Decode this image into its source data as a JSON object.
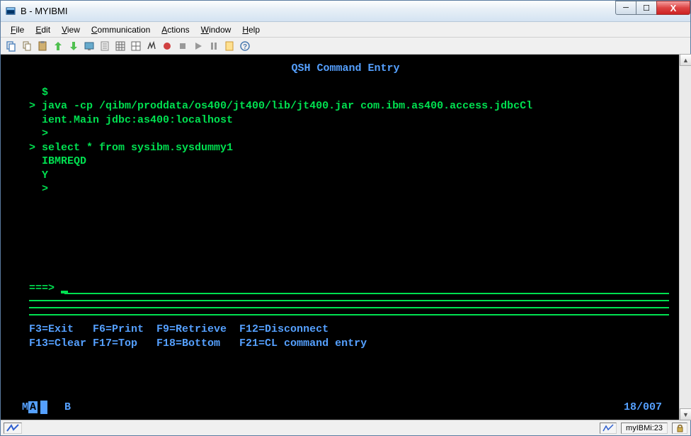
{
  "window": {
    "title": "B - MYIBMI"
  },
  "menu": {
    "items": [
      {
        "u": "F",
        "rest": "ile"
      },
      {
        "u": "E",
        "rest": "dit"
      },
      {
        "u": "V",
        "rest": "iew"
      },
      {
        "u": "C",
        "rest": "ommunication"
      },
      {
        "u": "A",
        "rest": "ctions"
      },
      {
        "u": "W",
        "rest": "indow"
      },
      {
        "u": "H",
        "rest": "elp"
      }
    ]
  },
  "terminal": {
    "title": "QSH Command Entry",
    "lines": {
      "l0": "  $",
      "l1": "> java -cp /qibm/proddata/os400/jt400/lib/jt400.jar com.ibm.as400.access.jdbcCl",
      "l2": "  ient.Main jdbc:as400:localhost",
      "l3": "  >",
      "l4": "> select * from sysibm.sysdummy1",
      "l5": "  IBMREQD",
      "l6": "  Y",
      "l7": "  >"
    },
    "prompt": "===> ",
    "fkeys": {
      "row1": "F3=Exit   F6=Print  F9=Retrieve  F12=Disconnect",
      "row2": "F13=Clear F17=Top   F18=Bottom   F21=CL command entry"
    },
    "status": {
      "ma": "MA",
      "b": "B",
      "pos": "18/007"
    }
  },
  "statusbar": {
    "connection": "myIBMi:23"
  }
}
